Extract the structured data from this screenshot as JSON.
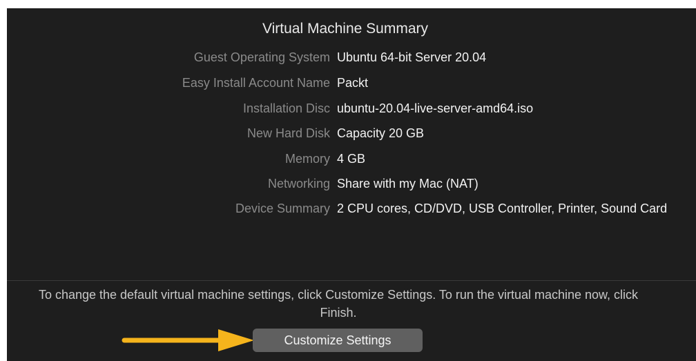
{
  "summary": {
    "title": "Virtual Machine Summary",
    "rows": [
      {
        "label": "Guest Operating System",
        "value": "Ubuntu 64-bit Server 20.04"
      },
      {
        "label": "Easy Install Account Name",
        "value": "Packt"
      },
      {
        "label": "Installation Disc",
        "value": "ubuntu-20.04-live-server-amd64.iso"
      },
      {
        "label": "New Hard Disk",
        "value": "Capacity 20 GB"
      },
      {
        "label": "Memory",
        "value": "4 GB"
      },
      {
        "label": "Networking",
        "value": "Share with my Mac (NAT)"
      },
      {
        "label": "Device Summary",
        "value": "2 CPU cores, CD/DVD, USB Controller, Printer, Sound Card"
      }
    ]
  },
  "footer": {
    "note": "To change the default virtual machine settings, click Customize Settings. To run the virtual machine now, click Finish.",
    "customize_label": "Customize Settings"
  },
  "annotation": {
    "icon": "arrow-right-icon",
    "color": "#f5b41c"
  },
  "colors": {
    "panel_bg": "#1e1e1e",
    "label": "#8a8a8a",
    "value": "#f2f2f2",
    "button_bg": "#606060"
  }
}
